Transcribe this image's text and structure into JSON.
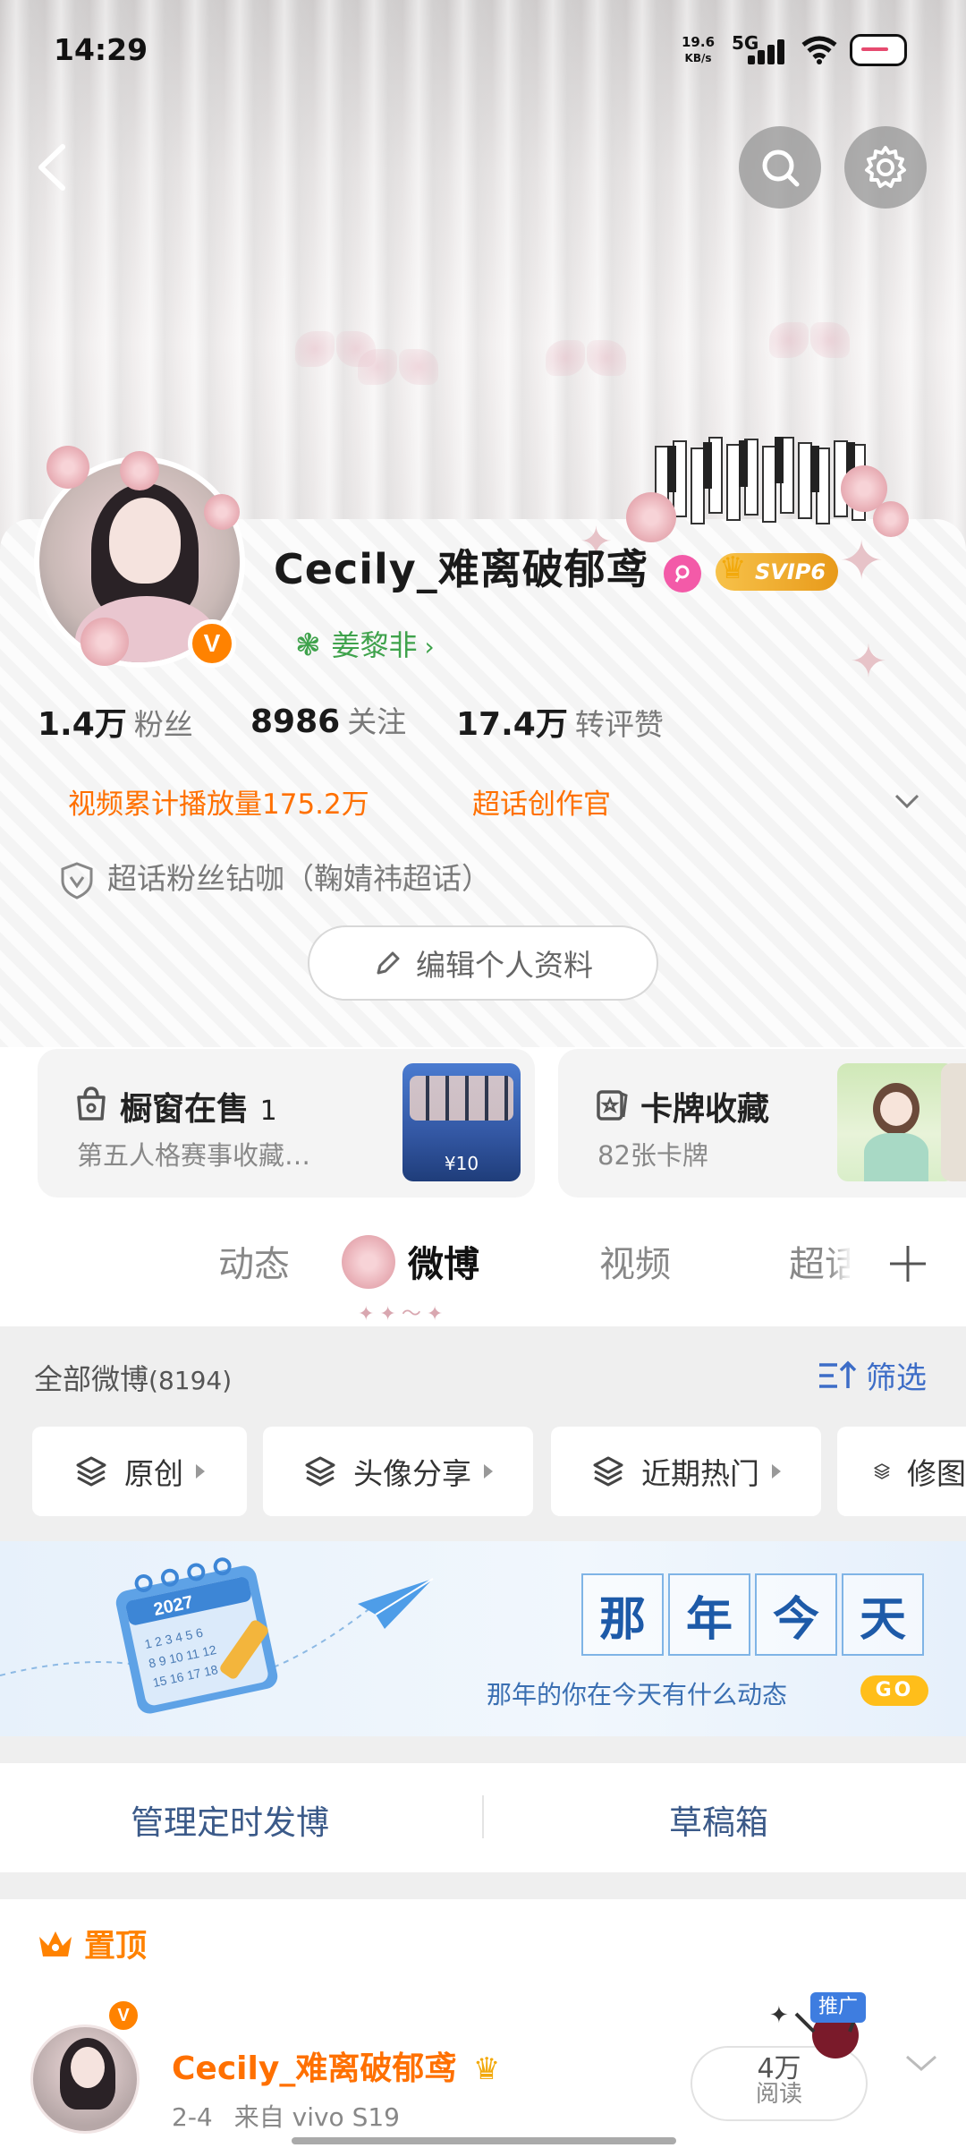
{
  "status_bar": {
    "time": "14:29",
    "net_speed_value": "19.6",
    "net_speed_unit": "KB/s",
    "network": "5G"
  },
  "header": {
    "back_icon": "chevron-left-icon",
    "search_icon": "search-icon",
    "settings_icon": "gear-icon"
  },
  "profile": {
    "username": "Cecily_难离破郁鸢",
    "svip_label": "SVIP6",
    "tag": "姜黎非",
    "stats": [
      {
        "value": "1.4万",
        "label": "粉丝"
      },
      {
        "value": "8986",
        "label": "关注"
      },
      {
        "value": "17.4万",
        "label": "转评赞"
      }
    ],
    "video_plays": "视频累计播放量175.2万",
    "creator_title": "超话创作官",
    "fan_title": "超话粉丝钻咖（鞠婧祎超话）",
    "edit_button": "编辑个人资料"
  },
  "cards": [
    {
      "title": "橱窗在售",
      "count": "1",
      "subtitle": "第五人格赛事收藏…",
      "price": "¥10"
    },
    {
      "title": "卡牌收藏",
      "subtitle": "82张卡牌"
    }
  ],
  "tabs": [
    "动态",
    "微博",
    "视频",
    "超话"
  ],
  "active_tab": "微博",
  "feed": {
    "all_label": "全部微博",
    "all_count": "(8194)",
    "filter_label": "筛选",
    "chips": [
      "原创",
      "头像分享",
      "近期热门",
      "修图"
    ]
  },
  "memory": {
    "year": "2027",
    "title_chars": [
      "那",
      "年",
      "今",
      "天"
    ],
    "subtitle": "那年的你在今天有什么动态",
    "go": "GO"
  },
  "manage": {
    "scheduled": "管理定时发博",
    "drafts": "草稿箱"
  },
  "pinned": {
    "label": "置顶",
    "author": "Cecily_难离破郁鸢",
    "date": "2-4",
    "source": "来自 vivo S19",
    "reads_value": "4万",
    "reads_label": "阅读",
    "promo": "推广"
  },
  "colors": {
    "accent_orange": "#ff8200",
    "link_blue": "#3d6dc7",
    "tag_green": "#3ea24b",
    "pink": "#f35aa8"
  }
}
